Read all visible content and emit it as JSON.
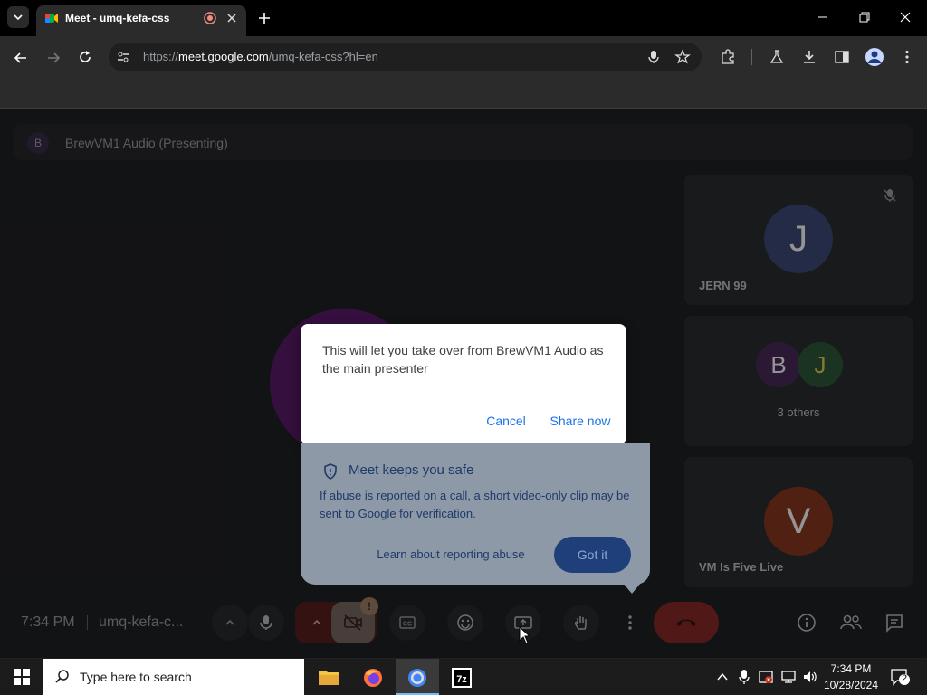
{
  "browser": {
    "tab_title": "Meet - umq-kefa-css",
    "url_prefix": "https://",
    "url_host": "meet.google.com",
    "url_path": "/umq-kefa-css?hl=en"
  },
  "meet": {
    "presenting_avatar_letter": "B",
    "presenting_text": "BrewVM1 Audio (Presenting)",
    "participants": [
      {
        "letter": "J",
        "name": "JERN 99",
        "color": "#3d4a7a"
      },
      {
        "letters": [
          "B",
          "J"
        ],
        "name": "3 others"
      },
      {
        "letter": "V",
        "name": "VM Is Five Live",
        "color": "#8a3a22"
      }
    ]
  },
  "dialog": {
    "message": "This will let you take over from BrewVM1 Audio as the main presenter",
    "cancel_label": "Cancel",
    "share_label": "Share now"
  },
  "safe_popup": {
    "title": "Meet keeps you safe",
    "body": "If abuse is reported on a call, a short video-only clip may be sent to Google for verification.",
    "link_label": "Learn about reporting abuse",
    "button_label": "Got it"
  },
  "bottom_bar": {
    "time": "7:34 PM",
    "meeting_code": "umq-kefa-c...",
    "camera_badge": "!"
  },
  "taskbar": {
    "search_placeholder": "Type here to search",
    "clock_time": "7:34 PM",
    "clock_date": "10/28/2024",
    "notification_count": "2"
  },
  "colors": {
    "accent_blue": "#1a73e8",
    "meet_bg": "#202124",
    "end_call_red": "#8c2a2a"
  }
}
